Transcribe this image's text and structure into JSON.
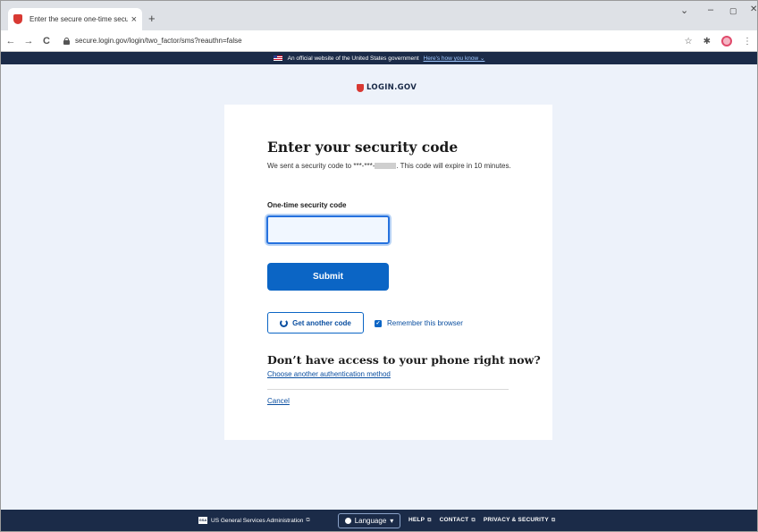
{
  "browser": {
    "tab_title": "Enter the secure one-time securi",
    "tab_close": "×",
    "new_tab": "+",
    "url": "secure.login.gov/login/two_factor/sms?reauthn=false",
    "window_controls": {
      "chevron": "⌄",
      "minimize": "–",
      "maximize": "▢",
      "close": "✕"
    },
    "nav": {
      "back": "←",
      "forward": "→",
      "reload": "C"
    },
    "toolbar_icons": {
      "bookmark": "☆",
      "extensions": "✱",
      "menu": "⋮"
    }
  },
  "gov_banner": {
    "text": "An official website of the United States government",
    "link": "Here's how you know ⌄"
  },
  "logo": {
    "text": "LOGIN.GOV"
  },
  "form": {
    "heading": "Enter your security code",
    "intro_before": "We sent a security code to ***-***-",
    "intro_after": ". This code will expire in 10 minutes.",
    "field_label": "One-time security code",
    "input_value": "",
    "submit_label": "Submit",
    "get_code_label": "Get another code",
    "remember_label": "Remember this browser",
    "remember_checked": true,
    "alt_heading": "Don’t have access to your phone right now?",
    "alt_link": "Choose another authentication method",
    "cancel_label": "Cancel"
  },
  "footer": {
    "gsa_badge": "GSA",
    "gsa_text": "US General Services Administration",
    "language_label": "Language",
    "language_caret": "▾",
    "links": [
      "HELP",
      "CONTACT",
      "PRIVACY & SECURITY"
    ],
    "ext_glyph": "⧉"
  },
  "colors": {
    "brand_navy": "#1b2b48",
    "primary_blue": "#0b65c5",
    "page_bg": "#edf2fa",
    "logo_red": "#d83933"
  }
}
